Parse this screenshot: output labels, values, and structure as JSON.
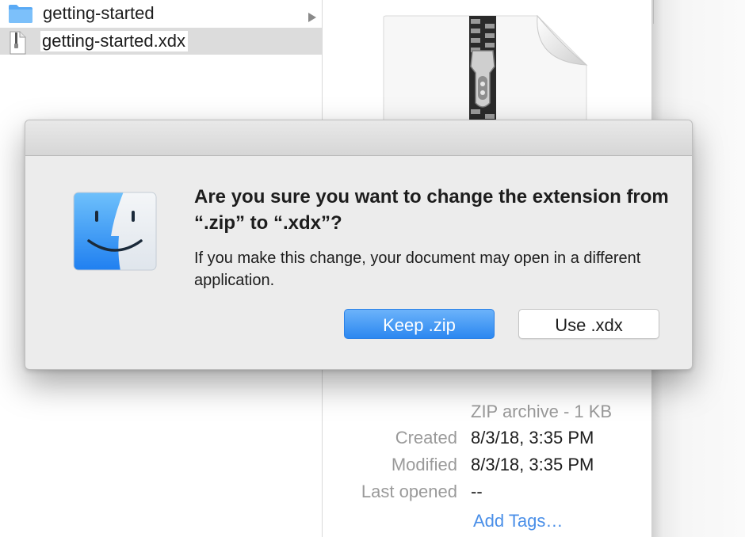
{
  "file_list": {
    "items": [
      {
        "name": "getting-started",
        "type": "folder",
        "icon": "folder-icon"
      },
      {
        "name": "getting-started.xdx",
        "type": "file",
        "icon": "zip-file-icon",
        "editing": true
      }
    ]
  },
  "preview": {
    "kind": "ZIP archive - 1 KB",
    "info": [
      {
        "key": "Created",
        "value": "8/3/18, 3:35 PM"
      },
      {
        "key": "Modified",
        "value": "8/3/18, 3:35 PM"
      },
      {
        "key": "Last opened",
        "value": "--"
      }
    ],
    "add_tags": "Add Tags…"
  },
  "dialog": {
    "heading": "Are you sure you want to change the extension from “.zip” to “.xdx”?",
    "body": "If you make this change, your document may open in a different application.",
    "primary_button": "Keep .zip",
    "secondary_button": "Use .xdx",
    "icon": "finder-icon"
  },
  "colors": {
    "accent": "#2b87f0",
    "link": "#4a8fe8",
    "folder": "#5aaaf5"
  }
}
